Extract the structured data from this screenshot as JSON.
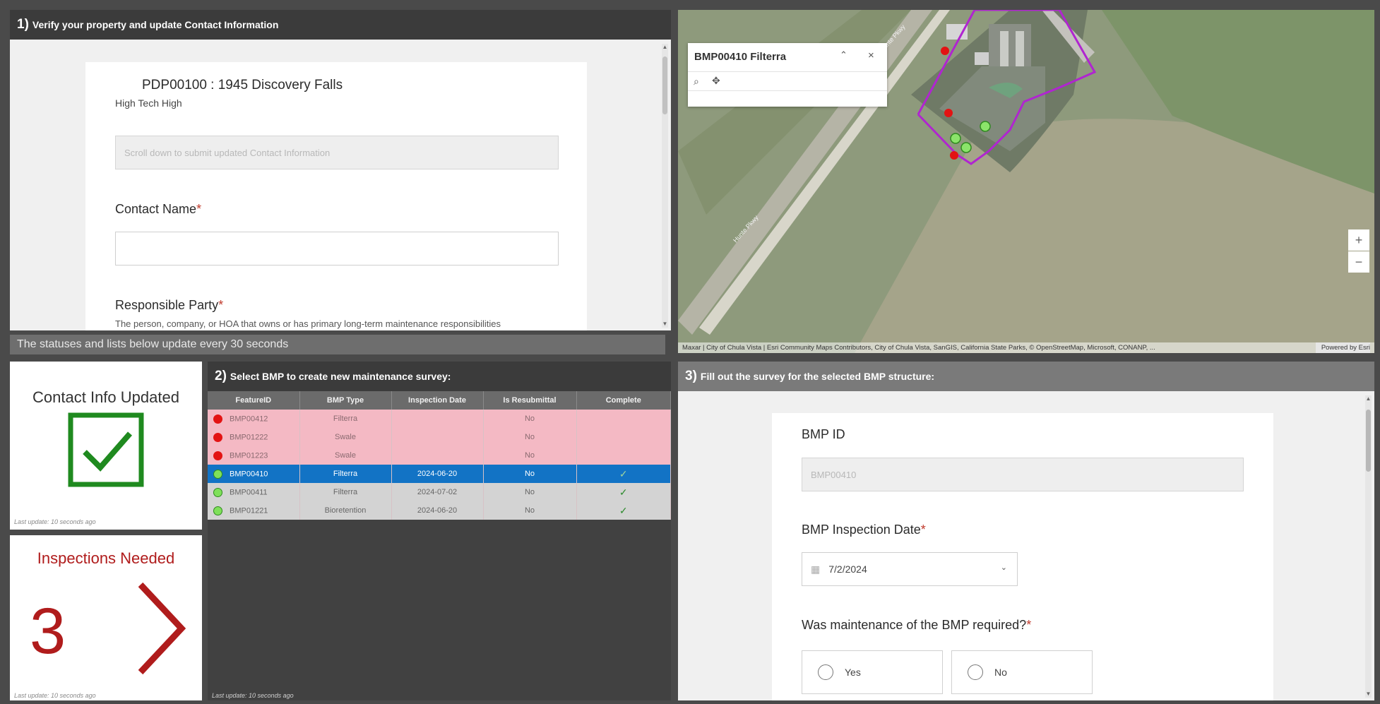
{
  "panel1": {
    "number": "1)",
    "heading": "Verify your property and update Contact Information",
    "property_title": "PDP00100 : 1945 Discovery Falls",
    "property_subtitle": "High Tech High",
    "info_placeholder": "Scroll down to submit updated Contact Information",
    "contact_name_label": "Contact Name",
    "responsible_party_label": "Responsible Party",
    "required_mark": "*",
    "responsible_party_desc": "The person, company, or HOA that owns or has primary long-term maintenance responsibilities for the BMP structure"
  },
  "status_bar": "The statuses and lists below update every 30 seconds",
  "contact_widget": {
    "title": "Contact Info Updated",
    "footer": "Last update: 10 seconds ago",
    "color": "#1f8a1f"
  },
  "inspections_widget": {
    "title": "Inspections Needed",
    "count": "3",
    "footer": "Last update: 10 seconds ago",
    "color": "#b01c1c"
  },
  "panel2": {
    "number": "2)",
    "heading": "Select BMP to create new maintenance survey:",
    "columns": [
      "FeatureID",
      "BMP Type",
      "Inspection Date",
      "Is Resubmittal",
      "Complete"
    ],
    "rows": [
      {
        "id": "BMP00412",
        "type": "Filterra",
        "date": "",
        "resubmittal": "No",
        "complete": "",
        "status": "red"
      },
      {
        "id": "BMP01222",
        "type": "Swale",
        "date": "",
        "resubmittal": "No",
        "complete": "",
        "status": "red"
      },
      {
        "id": "BMP01223",
        "type": "Swale",
        "date": "",
        "resubmittal": "No",
        "complete": "",
        "status": "red"
      },
      {
        "id": "BMP00410",
        "type": "Filterra",
        "date": "2024-06-20",
        "resubmittal": "No",
        "complete": "✓",
        "status": "selected"
      },
      {
        "id": "BMP00411",
        "type": "Filterra",
        "date": "2024-07-02",
        "resubmittal": "No",
        "complete": "✓",
        "status": "green"
      },
      {
        "id": "BMP01221",
        "type": "Bioretention",
        "date": "2024-06-20",
        "resubmittal": "No",
        "complete": "✓",
        "status": "green"
      }
    ],
    "footer": "Last update: 10 seconds ago"
  },
  "map": {
    "popup_title": "BMP00410 Filterra",
    "attribution": "Maxar | City of Chula Vista | Esri Community Maps Contributors, City of Chula Vista, SanGIS, California State Parks, © OpenStreetMap, Microsoft, CONANP, ...",
    "powered_by": "Powered by Esri",
    "road_labels": [
      "Hunte Pkwy",
      "Hunte Pkwy"
    ],
    "zoom_in": "+",
    "zoom_out": "−",
    "popup_collapse_icon": "chevron-up-icon",
    "popup_close_icon": "close-icon"
  },
  "panel3": {
    "number": "3)",
    "heading": "Fill out the survey for the selected BMP structure:",
    "bmp_id_label": "BMP ID",
    "bmp_id_value": "BMP00410",
    "inspection_date_label": "BMP Inspection Date",
    "inspection_date_value": "7/2/2024",
    "maintenance_question": "Was maintenance of the BMP required?",
    "required_mark": "*",
    "option_yes": "Yes",
    "option_no": "No"
  }
}
